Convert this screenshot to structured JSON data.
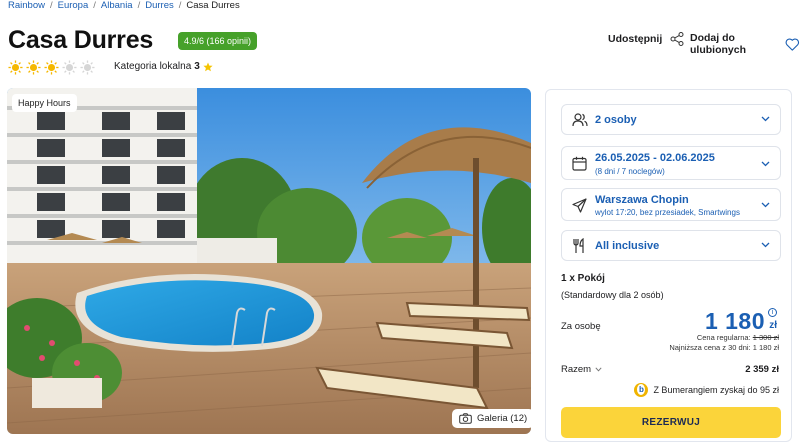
{
  "breadcrumb": {
    "items": [
      "Rainbow",
      "Europa",
      "Albania",
      "Durres"
    ],
    "current": "Casa Durres"
  },
  "hotel": {
    "name": "Casa Durres",
    "rating": "4.9/6 (166 opinii)",
    "suns_filled": 3,
    "suns_total": 5,
    "local_category_label": "Kategoria lokalna",
    "local_category_value": "3"
  },
  "actions": {
    "share_label": "Udostępnij",
    "favorite_label": "Dodaj do ulubionych"
  },
  "photo": {
    "badge": "Happy Hours",
    "gallery_label": "Galeria (12)"
  },
  "booking": {
    "guests": "2 osoby",
    "dates": "26.05.2025 - 02.06.2025",
    "dates_sub": "(8 dni / 7 noclegów)",
    "departure": "Warszawa Chopin",
    "departure_sub": "wylot 17:20, bez przesiadek, Smartwings",
    "board": "All inclusive",
    "room_count": "1 x Pokój",
    "room_type": "(Standardowy dla 2 osób)",
    "per_person_label": "Za osobę",
    "price": "1 180",
    "currency": "zł",
    "regular_price_label": "Cena regularna:",
    "regular_price": "1 300 zł",
    "lowest_price": "Najniższa cena z 30 dni: 1 180 zł",
    "total_label": "Razem",
    "total_value": "2 359 zł",
    "bumerang": "Z Bumerangiem zyskaj do 95 zł",
    "reserve_label": "REZERWUJ"
  },
  "colors": {
    "accent_blue": "#1b5fb3",
    "rating_green": "#46a12a",
    "reserve_yellow": "#fbd43a",
    "sun_yellow": "#f5b800"
  }
}
